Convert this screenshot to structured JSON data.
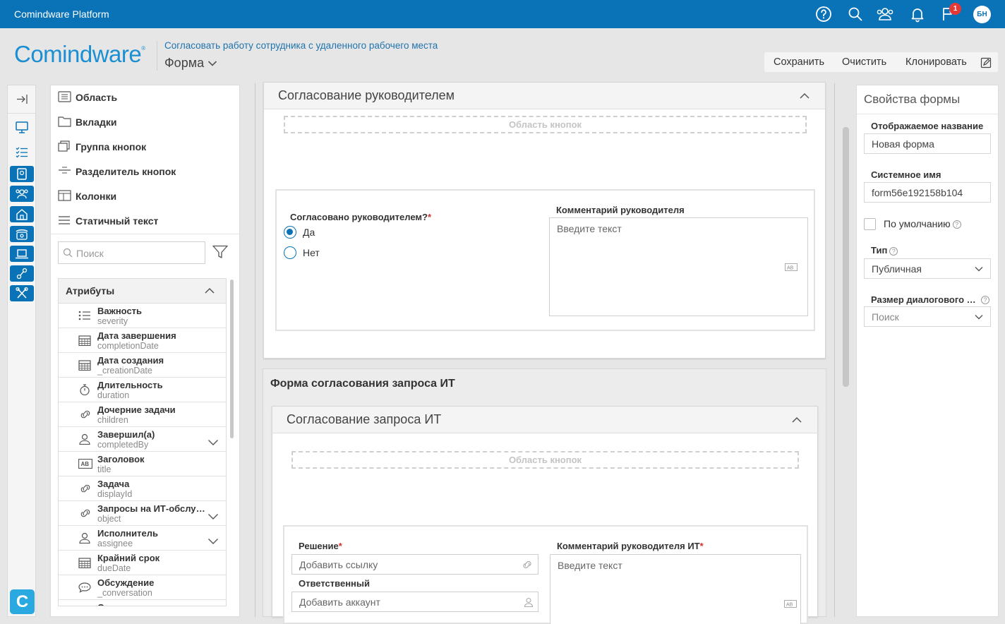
{
  "topbar": {
    "brand": "Comindware Platform",
    "notification_count": "1",
    "avatar_initials": "БН",
    "icons": [
      "help-icon",
      "search-icon",
      "users-icon",
      "bell-icon",
      "flag-icon"
    ]
  },
  "header": {
    "logo": "Comindware",
    "logo_mark": "®",
    "breadcrumb": "Согласовать работу сотрудника с удаленного рабочего места",
    "form_selector": "Форма",
    "actions": {
      "save": "Сохранить",
      "clear": "Очистить",
      "clone": "Клонировать"
    }
  },
  "palette": {
    "items": [
      {
        "label": "Область",
        "icon": "area-icon"
      },
      {
        "label": "Вкладки",
        "icon": "tabs-icon"
      },
      {
        "label": "Группа кнопок",
        "icon": "button-group-icon"
      },
      {
        "label": "Разделитель кнопок",
        "icon": "button-divider-icon"
      },
      {
        "label": "Колонки",
        "icon": "columns-icon"
      },
      {
        "label": "Статичный текст",
        "icon": "static-text-icon"
      }
    ],
    "search_placeholder": "Поиск",
    "attributes_title": "Атрибуты",
    "attributes": [
      {
        "label": "Важность",
        "system": "severity",
        "icon": "list-icon",
        "expandable": false
      },
      {
        "label": "Дата завершения",
        "system": "completionDate",
        "icon": "calendar-icon",
        "expandable": false
      },
      {
        "label": "Дата создания",
        "system": "_creationDate",
        "icon": "calendar-icon",
        "expandable": false
      },
      {
        "label": "Длительность",
        "system": "duration",
        "icon": "stopwatch-icon",
        "expandable": false
      },
      {
        "label": "Дочерние задачи",
        "system": "children",
        "icon": "link-icon",
        "expandable": false
      },
      {
        "label": "Завершил(а)",
        "system": "completedBy",
        "icon": "user-icon",
        "expandable": true
      },
      {
        "label": "Заголовок",
        "system": "title",
        "icon": "text-ab-icon",
        "expandable": false
      },
      {
        "label": "Задача",
        "system": "displayId",
        "icon": "link-icon",
        "expandable": false
      },
      {
        "label": "Запросы на ИТ-обслуживание",
        "system": "object",
        "icon": "link-icon",
        "expandable": true
      },
      {
        "label": "Исполнитель",
        "system": "assignee",
        "icon": "user-icon",
        "expandable": true
      },
      {
        "label": "Крайний срок",
        "system": "dueDate",
        "icon": "calendar-icon",
        "expandable": false
      },
      {
        "label": "Обсуждение",
        "system": "_conversation",
        "icon": "chat-icon",
        "expandable": false
      },
      {
        "label": "Ожидаемая дата завершения",
        "system": "",
        "icon": "calendar-icon",
        "expandable": false
      }
    ]
  },
  "canvas": {
    "card1": {
      "title": "Согласование руководителем",
      "button_area": "Область кнопок",
      "question_label": "Согласовано руководителем?",
      "required_mark": "*",
      "options": [
        "Да",
        "Нет"
      ],
      "selected_option": "Да",
      "comment_label": "Комментарий руководителя",
      "comment_placeholder": "Введите текст"
    },
    "section": {
      "title": "Форма согласования запроса ИТ",
      "card": {
        "title": "Согласование запроса ИТ",
        "button_area": "Область кнопок",
        "decision_label": "Решение",
        "decision_placeholder": "Добавить ссылку",
        "responsible_label": "Ответственный",
        "responsible_placeholder": "Добавить аккаунт",
        "comment_label": "Комментарий руководителя ИТ",
        "comment_placeholder": "Введите текст",
        "required_mark": "*"
      }
    }
  },
  "properties": {
    "title": "Свойства формы",
    "display_name_label": "Отображаемое название",
    "display_name_value": "Новая форма",
    "system_name_label": "Системное имя",
    "system_name_value": "form56e192158b104",
    "default_label": "По умолчанию",
    "type_label": "Тип",
    "type_value": "Публичная",
    "dialog_size_label": "Размер диалогового окна",
    "dialog_size_placeholder": "Поиск",
    "help_mark": "?"
  }
}
